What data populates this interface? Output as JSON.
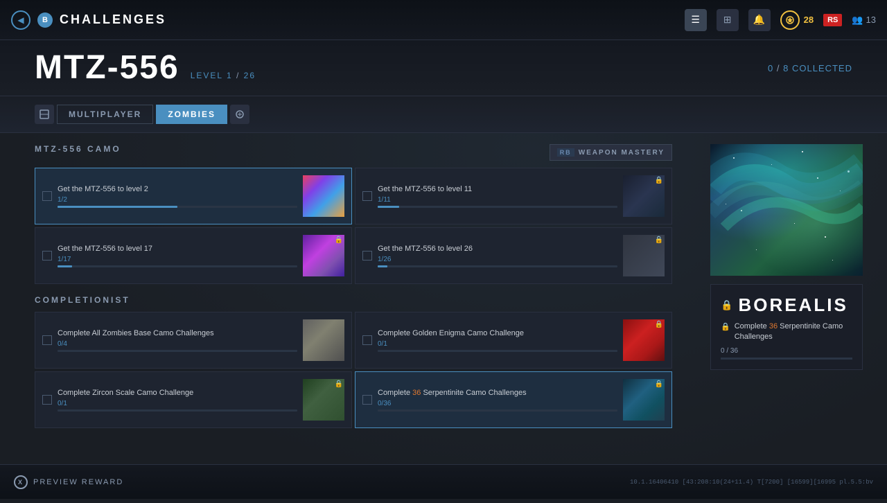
{
  "header": {
    "back_icon": "◀",
    "b_label": "B",
    "title": "CHALLENGES",
    "icons": {
      "menu": "☰",
      "grid": "⊞",
      "bell": "🔔",
      "xp_icon": "⬡",
      "xp_value": "28",
      "rs_label": "RS",
      "players_icon": "👥",
      "players_count": "13"
    }
  },
  "weapon": {
    "name": "MTZ-556",
    "level_label": "LEVEL",
    "level_current": "1",
    "level_max": "26",
    "collected_current": "0",
    "collected_max": "8",
    "collected_suffix": "COLLECTED"
  },
  "tabs": {
    "tab_icon_left": "⬛",
    "multiplayer_label": "MULTIPLAYER",
    "zombies_label": "ZOMBIES",
    "tab_icon_right": "⬛"
  },
  "camo_section": {
    "title": "MTZ-556 CAMO",
    "weapon_mastery_label": "WEAPON MASTERY",
    "rb_label": "RB"
  },
  "challenges": [
    {
      "label": "Get the MTZ-556 to level 2",
      "progress_text": "1/2",
      "progress_pct": 50,
      "thumb_type": "colorful",
      "locked": false,
      "selected": true
    },
    {
      "label": "Get the MTZ-556 to level 11",
      "progress_text": "1/11",
      "progress_pct": 9,
      "thumb_type": "dark",
      "locked": true,
      "selected": false
    },
    {
      "label": "Get the MTZ-556 to level 17",
      "progress_text": "1/17",
      "progress_pct": 6,
      "thumb_type": "purple",
      "locked": true,
      "selected": false
    },
    {
      "label": "Get the MTZ-556 to level 26",
      "progress_text": "1/26",
      "progress_pct": 4,
      "thumb_type": "gray_locked",
      "locked": true,
      "selected": false
    }
  ],
  "completionist": {
    "title": "COMPLETIONIST",
    "challenges": [
      {
        "label": "Complete All Zombies Base Camo Challenges",
        "progress_text": "0/4",
        "progress_pct": 0,
        "thumb_type": "stone",
        "locked": false,
        "selected": false
      },
      {
        "label": "Complete Golden Enigma Camo Challenge",
        "progress_text": "0/1",
        "progress_pct": 0,
        "thumb_type": "red",
        "locked": true,
        "selected": false
      },
      {
        "label": "Complete Zircon Scale Camo Challenge",
        "progress_text": "0/1",
        "progress_pct": 0,
        "thumb_type": "green",
        "locked": true,
        "selected": false
      },
      {
        "label": "Complete 36 Serpentinite Camo Challenges",
        "progress_text": "0/36",
        "progress_pct": 0,
        "thumb_type": "teal",
        "locked": true,
        "selected": true,
        "highlight_number": "36"
      }
    ]
  },
  "borealis": {
    "lock_icon": "🔒",
    "title": "BOREALIS",
    "challenge_text_pre": "Complete ",
    "challenge_number": "36",
    "challenge_text_post": " Serpentinite Camo Challenges",
    "progress_text": "0 / 36",
    "progress_pct": 0
  },
  "footer": {
    "x_label": "X",
    "preview_label": "PREVIEW REWARD",
    "debug_text": "10.1.16406410 [43:208:10(24+11.4) T[7200] [16599][16995 pl.5.5:bv"
  }
}
